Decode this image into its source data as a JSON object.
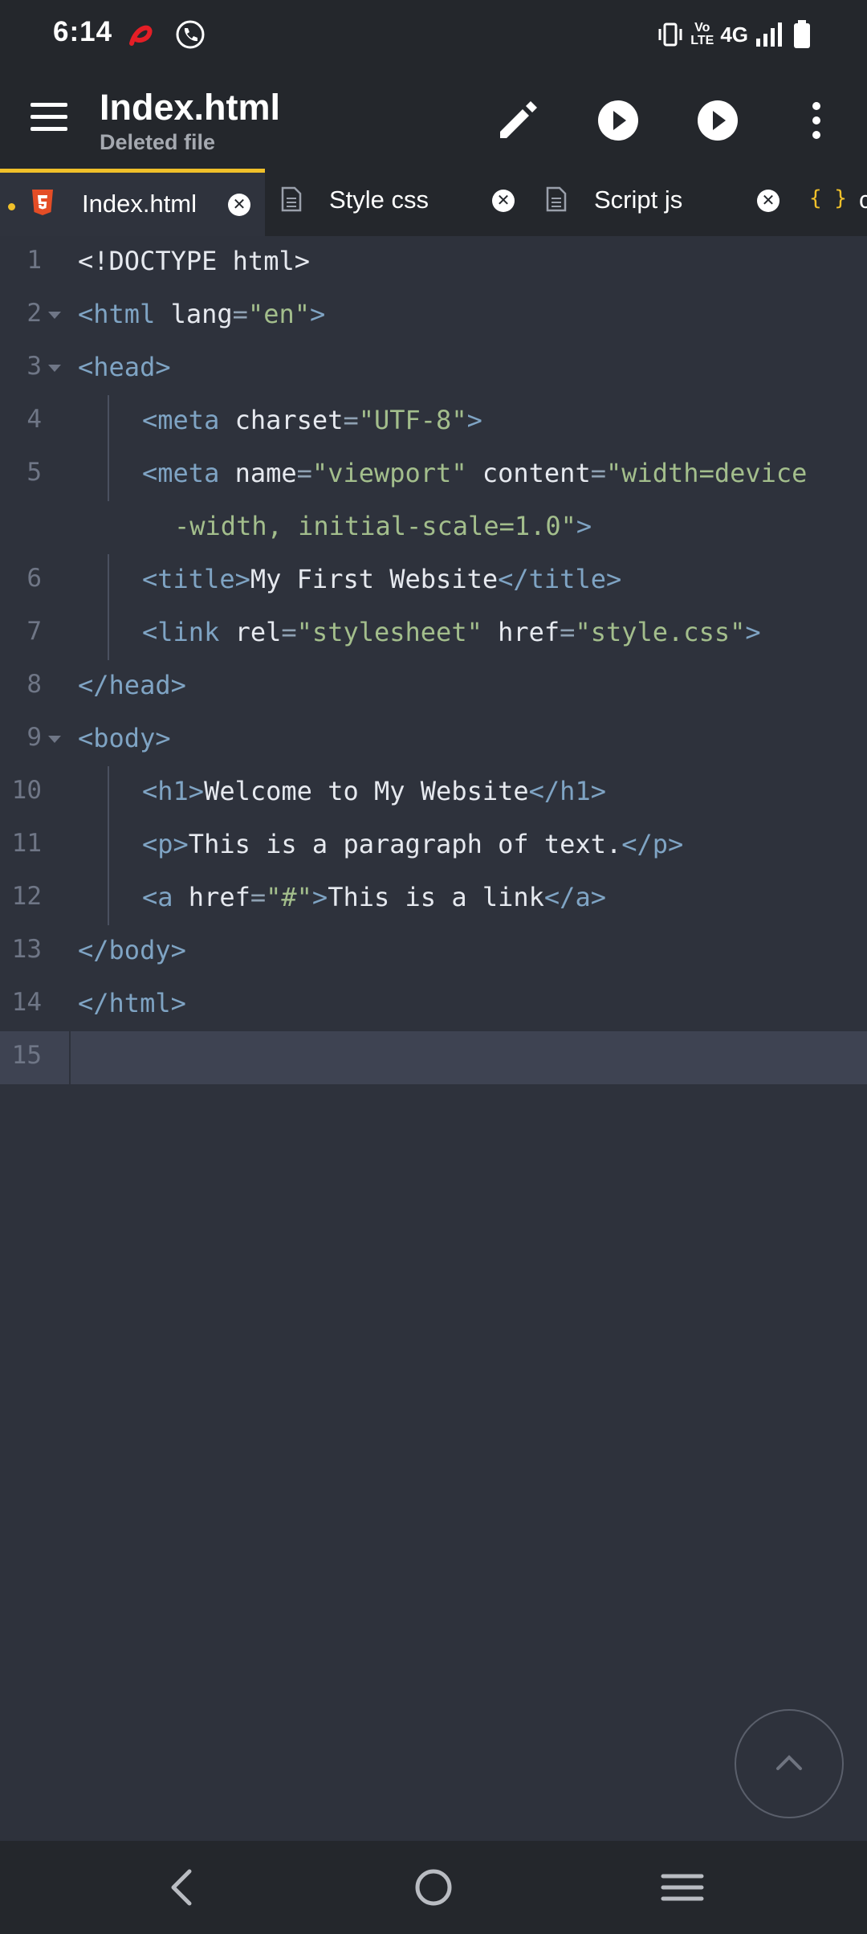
{
  "status_bar": {
    "time": "6:14",
    "network": "4G",
    "volte_line1": "Vo",
    "volte_line2": "LTE"
  },
  "app_bar": {
    "title": "Index.html",
    "subtitle": "Deleted file",
    "icons": [
      "menu-icon",
      "pencil-icon",
      "play-icon",
      "play-icon",
      "more-vert-icon"
    ]
  },
  "tabs": [
    {
      "label": "Index.html",
      "icon": "html5-icon",
      "active": true,
      "unsaved": true
    },
    {
      "label": "Style css",
      "icon": "file-icon",
      "active": false
    },
    {
      "label": "Script js",
      "icon": "file-icon",
      "active": false
    },
    {
      "label": "c",
      "icon": "json-braces-icon",
      "active": false
    }
  ],
  "editor": {
    "line_numbers": [
      "1",
      "2",
      "3",
      "4",
      "5",
      "6",
      "7",
      "8",
      "9",
      "10",
      "11",
      "12",
      "13",
      "14",
      "15"
    ],
    "code": {
      "l1": "<!DOCTYPE html>",
      "l2_open": "<html",
      "l2_attr": " lang",
      "l2_eq": "=",
      "l2_val": "\"en\"",
      "l2_close": ">",
      "l3": "<head>",
      "l4_open": "<meta",
      "l4_attr": " charset",
      "l4_eq": "=",
      "l4_val": "\"UTF-8\"",
      "l4_close": ">",
      "l5_open": "<meta",
      "l5_attr1": " name",
      "l5_eq1": "=",
      "l5_val1": "\"viewport\"",
      "l5_attr2": " content",
      "l5_eq2": "=",
      "l5_val2a": "\"width=device",
      "l5_val2b": "-width, initial-scale=1.0\"",
      "l5_close": ">",
      "l6_open": "<title>",
      "l6_text": "My First Website",
      "l6_close": "</title>",
      "l7_open": "<link",
      "l7_attr1": " rel",
      "l7_eq1": "=",
      "l7_val1": "\"stylesheet\"",
      "l7_attr2": " href",
      "l7_eq2": "=",
      "l7_val2": "\"style.css\"",
      "l7_close": ">",
      "l8": "</head>",
      "l9": "<body>",
      "l10_open": "<h1>",
      "l10_text": "Welcome to My Website",
      "l10_close": "</h1>",
      "l11_open": "<p>",
      "l11_text": "This is a paragraph of text.",
      "l11_close": "</p>",
      "l12_open": "<a",
      "l12_attr": " href",
      "l12_eq": "=",
      "l12_val": "\"#\"",
      "l12_gt": ">",
      "l12_text": "This is a link",
      "l12_close": "</a>",
      "l13": "</body>",
      "l14": "</html>"
    }
  },
  "fab": {
    "icon": "chevron-up-icon"
  },
  "nav_bar": {
    "icons": [
      "back-icon",
      "home-icon",
      "recents-icon"
    ]
  },
  "colors": {
    "background": "#2e323c",
    "bar": "#24272c",
    "accent": "#f0c02a",
    "tag": "#7fa4c4",
    "string": "#a3be8c"
  }
}
